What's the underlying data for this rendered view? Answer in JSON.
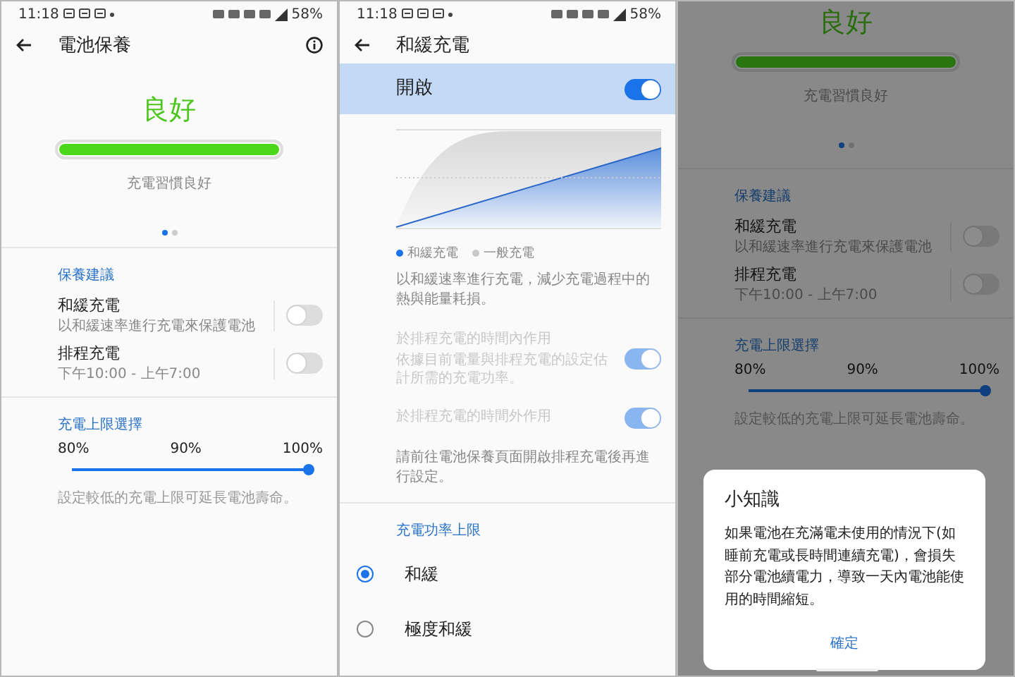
{
  "screens": [
    {
      "kind": "battery_care",
      "status_bar": {
        "time": "11:18",
        "battery": "58%"
      },
      "title": "電池保養",
      "health": {
        "rating": "良好",
        "level": 1,
        "caption": "充電習慣良好",
        "pages": [
          {
            "selected": true
          },
          {
            "selected": false
          }
        ]
      },
      "suggestions": {
        "heading": "保養建議",
        "items": [
          {
            "title": "和緩充電",
            "subtitle": "以和緩速率進行充電來保護電池",
            "on": false
          },
          {
            "title": "排程充電",
            "subtitle": "下午10:00 - 上午7:00",
            "on": false
          }
        ]
      },
      "limit": {
        "heading": "充電上限選擇",
        "ticks": [
          "80%",
          "90%",
          "100%"
        ],
        "level": 1,
        "note": "設定較低的充電上限可延長電池壽命。"
      }
    },
    {
      "kind": "gentle_charging",
      "status_bar": {
        "time": "11:18",
        "battery": "58%"
      },
      "title": "和緩充電",
      "master": {
        "label": "開啟",
        "on": true
      },
      "legend": [
        {
          "label": "和緩充電",
          "color": "#1a73e8"
        },
        {
          "label": "一般充電",
          "color": "#c8c8c8"
        }
      ],
      "description": "以和緩速率進行充電，減少充電過程中的熱與能量耗損。",
      "options": [
        {
          "title": "於排程充電的時間內作用",
          "subtitle": "依據目前電量與排程充電的設定估計所需的充電功率。",
          "on": true,
          "disabled": true
        },
        {
          "title": "於排程充電的時間外作用",
          "on": true,
          "disabled": true
        }
      ],
      "note": "請前往電池保養頁面開啟排程充電後再進行設定。",
      "power": {
        "heading": "充電功率上限",
        "choices": [
          {
            "label": "和緩",
            "selected": true
          },
          {
            "label": "極度和緩",
            "selected": false
          }
        ]
      }
    },
    {
      "kind": "battery_care",
      "health": {
        "rating": "良好",
        "level": 1,
        "caption": "充電習慣良好",
        "pages": [
          {
            "selected": true
          },
          {
            "selected": false
          }
        ]
      },
      "suggestions": {
        "heading": "保養建議",
        "items": [
          {
            "title": "和緩充電",
            "subtitle": "以和緩速率進行充電來保護電池",
            "on": false
          },
          {
            "title": "排程充電",
            "subtitle": "下午10:00 - 上午7:00",
            "on": false
          }
        ]
      },
      "limit": {
        "heading": "充電上限選擇",
        "ticks": [
          "80%",
          "90%",
          "100%"
        ],
        "level": 1,
        "note": "設定較低的充電上限可延長電池壽命。"
      },
      "dialog": {
        "title": "小知識",
        "body": "如果電池在充滿電未使用的情況下(如睡前充電或長時間連續充電)，會損失部分電池續電力，導致一天內電池能使用的時間縮短。",
        "button": "確定"
      }
    }
  ]
}
